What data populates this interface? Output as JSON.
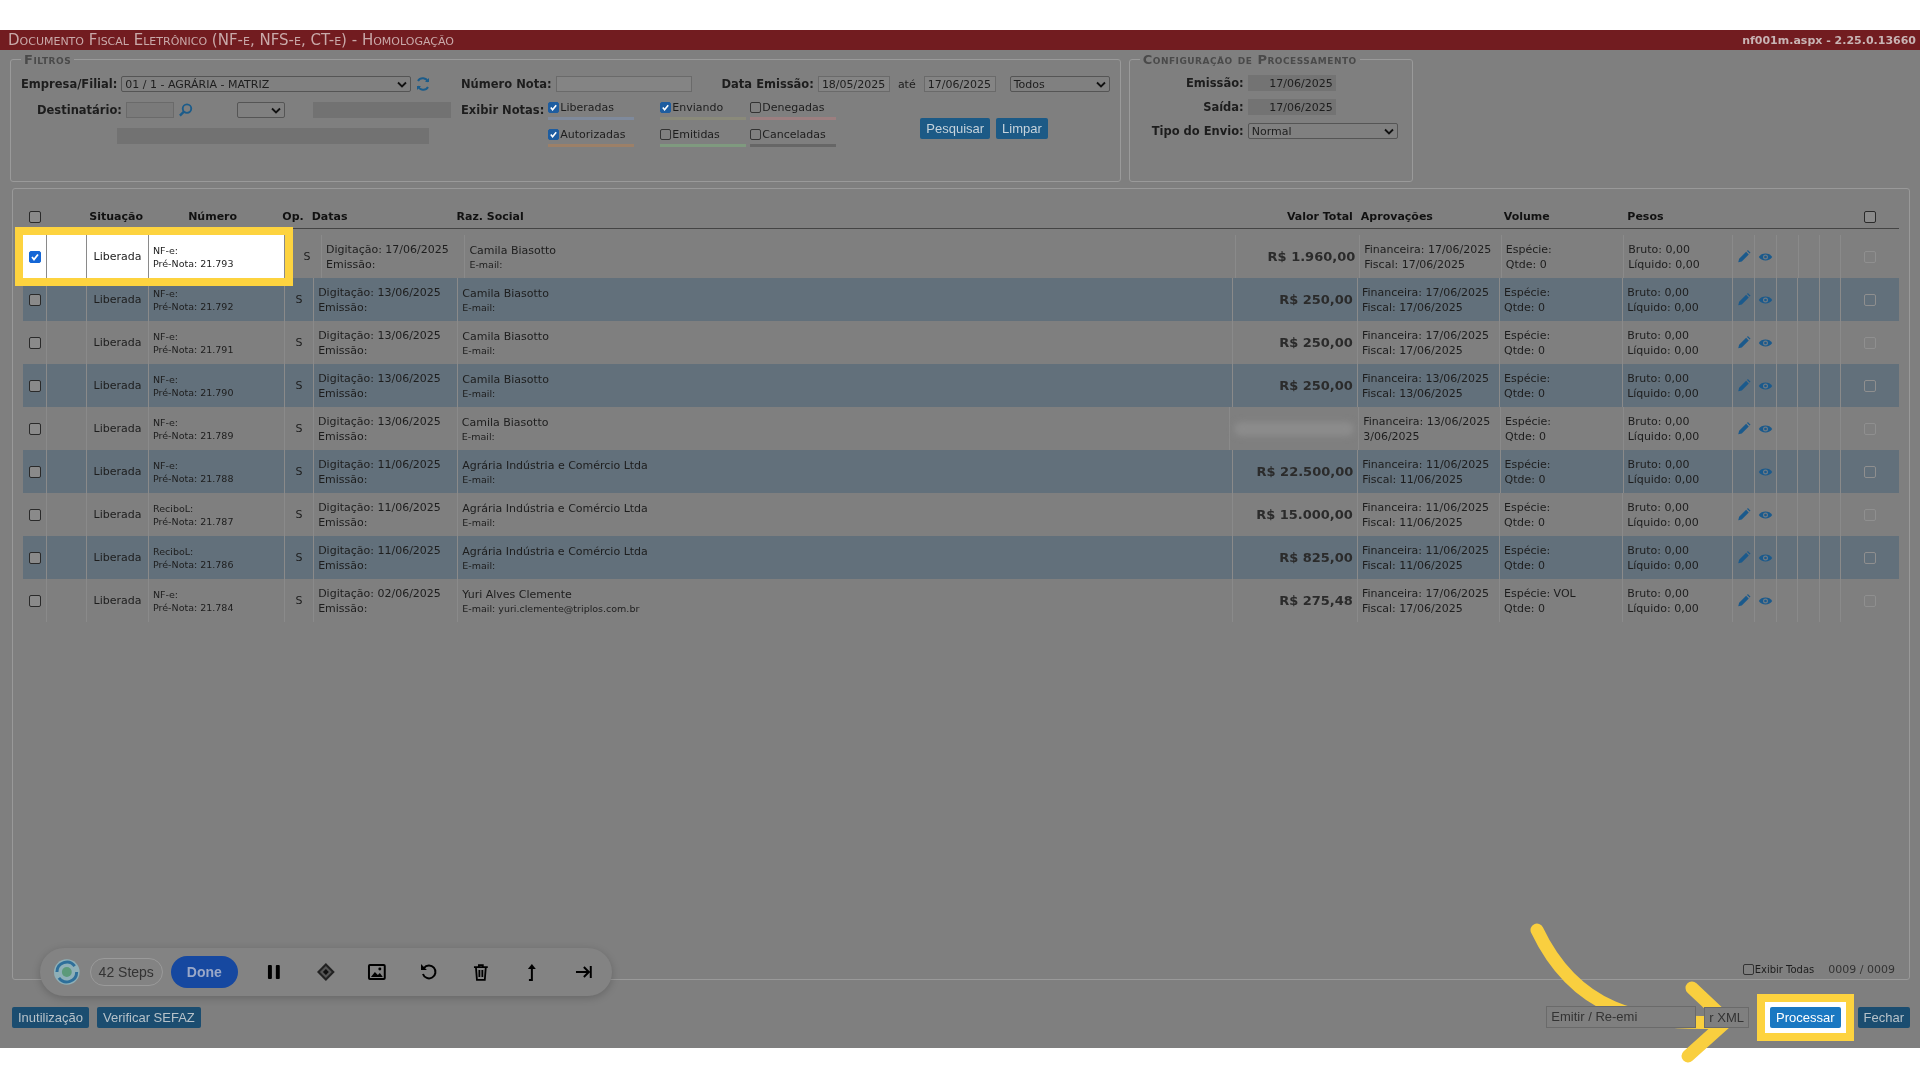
{
  "title_bar": {
    "title": "Documento Fiscal Eletrônico (NF-e, NFS-e, CT-e)  - Homologação",
    "version": "nf001m.aspx - 2.25.0.13660"
  },
  "filters": {
    "legend": "Filtros",
    "empresa_label": "Empresa/Filial:",
    "empresa_value": "01 / 1 - AGRÁRIA - MATRIZ",
    "destinatario_label": "Destinatário:",
    "numero_label": "Número Nota:",
    "data_label": "Data Emissão:",
    "data_from": "18/05/2025",
    "ate": "até",
    "data_to": "17/06/2025",
    "period": "Todos",
    "exibir_label": "Exibir Notas:",
    "options": [
      {
        "label": "Liberadas",
        "checked": true,
        "color": "#7f8a9c"
      },
      {
        "label": "Enviando",
        "checked": true,
        "color": "#8a8a7a"
      },
      {
        "label": "Denegadas",
        "checked": false,
        "color": "#9c7f80"
      },
      {
        "label": "Autorizadas",
        "checked": true,
        "color": "#9c8068"
      },
      {
        "label": "Emitidas",
        "checked": false,
        "color": "#7f9a7f"
      },
      {
        "label": "Canceladas",
        "checked": false,
        "color": "#666666"
      }
    ],
    "buttons": [
      "Pesquisar",
      "Limpar"
    ]
  },
  "config": {
    "legend": "Configuração de Processamento",
    "emissao_label": "Emissão:",
    "emissao": "17/06/2025",
    "saida_label": "Saída:",
    "saida": "17/06/2025",
    "tipo_label": "Tipo do Envio:",
    "tipo": "Normal"
  },
  "table": {
    "columns": [
      "Situação",
      "Número",
      "Op.",
      "Datas",
      "Raz. Social",
      "Valor Total",
      "Aprovações",
      "Volume",
      "Pesos"
    ],
    "all_checked": false,
    "right_checked": false,
    "rows": [
      {
        "checked": true,
        "highlighted": true,
        "situacao": "Liberada",
        "numero": [
          "NF-e:",
          "Pré-Nota:  21.793"
        ],
        "op": "S",
        "datas": [
          "Digitação:  17/06/2025",
          "Emissão:"
        ],
        "razao": "Camila Biasotto",
        "email": "E-mail:",
        "valor": "R$ 1.960,00",
        "aprovacoes": [
          "Financeira:  17/06/2025",
          "Fiscal:  17/06/2025"
        ],
        "volume": [
          "Espécie:",
          "Qtde:  0"
        ],
        "pesos": [
          "Bruto:  0,00",
          "Líquido:  0,00"
        ],
        "editable": true,
        "right_checked": false
      },
      {
        "checked": false,
        "highlighted": false,
        "situacao": "Liberada",
        "numero": [
          "NF-e:",
          "Pré-Nota:  21.792"
        ],
        "op": "S",
        "datas": [
          "Digitação:  13/06/2025",
          "Emissão:"
        ],
        "razao": "Camila Biasotto",
        "email": "E-mail:",
        "valor": "R$ 250,00",
        "aprovacoes": [
          "Financeira:  17/06/2025",
          "Fiscal:  17/06/2025"
        ],
        "volume": [
          "Espécie:",
          "Qtde:  0"
        ],
        "pesos": [
          "Bruto:  0,00",
          "Líquido:  0,00"
        ],
        "editable": true,
        "right_checked": false
      },
      {
        "checked": false,
        "highlighted": false,
        "situacao": "Liberada",
        "numero": [
          "NF-e:",
          "Pré-Nota:  21.791"
        ],
        "op": "S",
        "datas": [
          "Digitação:  13/06/2025",
          "Emissão:"
        ],
        "razao": "Camila Biasotto",
        "email": "E-mail:",
        "valor": "R$ 250,00",
        "aprovacoes": [
          "Financeira:  17/06/2025",
          "Fiscal:  17/06/2025"
        ],
        "volume": [
          "Espécie:",
          "Qtde:  0"
        ],
        "pesos": [
          "Bruto:  0,00",
          "Líquido:  0,00"
        ],
        "editable": true,
        "right_checked": false
      },
      {
        "checked": false,
        "highlighted": false,
        "situacao": "Liberada",
        "numero": [
          "NF-e:",
          "Pré-Nota:  21.790"
        ],
        "op": "S",
        "datas": [
          "Digitação:  13/06/2025",
          "Emissão:"
        ],
        "razao": "Camila Biasotto",
        "email": "E-mail:",
        "valor": "R$ 250,00",
        "aprovacoes": [
          "Financeira:  13/06/2025",
          "Fiscal:  13/06/2025"
        ],
        "volume": [
          "Espécie:",
          "Qtde:  0"
        ],
        "pesos": [
          "Bruto:  0,00",
          "Líquido:  0,00"
        ],
        "editable": true,
        "right_checked": false
      },
      {
        "checked": false,
        "highlighted": false,
        "situacao": "Liberada",
        "numero": [
          "NF-e:",
          "Pré-Nota:  21.789"
        ],
        "op": "S",
        "datas": [
          "Digitação:  13/06/2025",
          "Emissão:"
        ],
        "razao": "Camila Biasotto",
        "email": "E-mail:",
        "aprovacoes": [
          "Financeira:  13/06/2025",
          "3/06/2025"
        ],
        "volume": [
          "Espécie:",
          "Qtde:  0"
        ],
        "pesos": [
          "Bruto:  0,00",
          "Líquido:  0,00"
        ],
        "editable": true,
        "right_checked": false
      },
      {
        "checked": false,
        "highlighted": false,
        "situacao": "Liberada",
        "numero": [
          "NF-e:",
          "Pré-Nota:  21.788"
        ],
        "op": "S",
        "datas": [
          "Digitação:  11/06/2025",
          "Emissão:"
        ],
        "razao": "Agrária Indústria e Comércio Ltda",
        "email": "E-mail:",
        "valor": "R$ 22.500,00",
        "aprovacoes": [
          "Financeira:  11/06/2025",
          "Fiscal:  11/06/2025"
        ],
        "volume": [
          "Espécie:",
          "Qtde:  0"
        ],
        "pesos": [
          "Bruto:  0,00",
          "Líquido:  0,00"
        ],
        "editable": false,
        "right_checked": false
      },
      {
        "checked": false,
        "highlighted": false,
        "situacao": "Liberada",
        "numero": [
          "ReciboL:",
          "Pré-Nota:  21.787"
        ],
        "op": "S",
        "datas": [
          "Digitação:  11/06/2025",
          "Emissão:"
        ],
        "razao": "Agrária Indústria e Comércio Ltda",
        "email": "E-mail:",
        "valor": "R$ 15.000,00",
        "aprovacoes": [
          "Financeira:  11/06/2025",
          "Fiscal:  11/06/2025"
        ],
        "volume": [
          "Espécie:",
          "Qtde:  0"
        ],
        "pesos": [
          "Bruto:  0,00",
          "Líquido:  0,00"
        ],
        "editable": true,
        "right_checked": false
      },
      {
        "checked": false,
        "highlighted": false,
        "situacao": "Liberada",
        "numero": [
          "ReciboL:",
          "Pré-Nota:  21.786"
        ],
        "op": "S",
        "datas": [
          "Digitação:  11/06/2025",
          "Emissão:"
        ],
        "razao": "Agrária Indústria e Comércio Ltda",
        "email": "E-mail:",
        "valor": "R$ 825,00",
        "aprovacoes": [
          "Financeira:  11/06/2025",
          "Fiscal:  11/06/2025"
        ],
        "volume": [
          "Espécie:",
          "Qtde:  0"
        ],
        "pesos": [
          "Bruto:  0,00",
          "Líquido:  0,00"
        ],
        "editable": true,
        "right_checked": false
      },
      {
        "checked": false,
        "highlighted": false,
        "situacao": "Liberada",
        "numero": [
          "NF-e:",
          "Pré-Nota:  21.784"
        ],
        "op": "S",
        "datas": [
          "Digitação:  02/06/2025",
          "Emissão:"
        ],
        "razao": "Yuri Alves Clemente",
        "email": "E-mail: yuri.clemente@triplos.com.br",
        "valor": "R$ 275,48",
        "aprovacoes": [
          "Financeira:  17/06/2025",
          "Fiscal:  17/06/2025"
        ],
        "volume": [
          "Espécie:  VOL",
          "Qtde:  0"
        ],
        "pesos": [
          "Bruto:  0,00",
          "Líquido:  0,00"
        ],
        "editable": true,
        "right_checked": false
      }
    ]
  },
  "footer": {
    "exibir_todas": {
      "label": "Exibir Todas",
      "checked": false
    },
    "count": "0009 / 0009"
  },
  "recorder": {
    "steps": "42 Steps",
    "done": "Done"
  },
  "actions_left": [
    "Inutilização",
    "Verificar SEFAZ"
  ],
  "actions_right": {
    "emitir_placeholder": "Emitir / Re-emi",
    "xml": "r XML",
    "processar": {
      "label": "Processar",
      "highlighted": true
    },
    "fechar": "Fechar"
  }
}
